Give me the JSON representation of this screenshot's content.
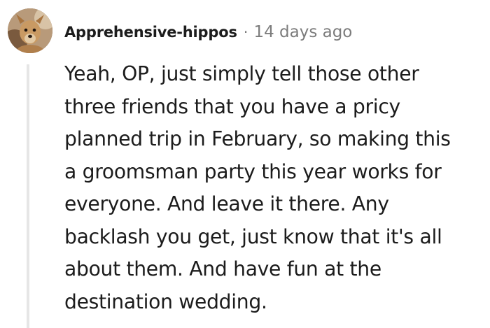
{
  "comment": {
    "author": "Apprehensive-hippos",
    "separator": "·",
    "timestamp": "14 days ago",
    "avatar_icon": "dog-avatar-icon",
    "body_lines": [
      "Yeah, OP, just simply tell those other",
      "three friends that you have a pricy",
      "planned trip in February, so making this",
      "a groomsman party this year works for",
      "everyone. And leave it there. Any",
      "backlash you get, just know that it's all",
      "about them. And have fun at the",
      "destination wedding."
    ]
  },
  "colors": {
    "text": "#1c1c1c",
    "meta": "#7c7c7c",
    "thread_line": "#e6e6e6"
  }
}
